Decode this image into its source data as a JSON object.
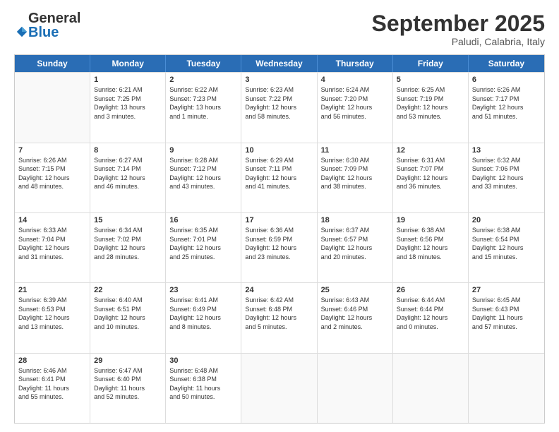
{
  "logo": {
    "general": "General",
    "blue": "Blue"
  },
  "title": "September 2025",
  "subtitle": "Paludi, Calabria, Italy",
  "headers": [
    "Sunday",
    "Monday",
    "Tuesday",
    "Wednesday",
    "Thursday",
    "Friday",
    "Saturday"
  ],
  "rows": [
    [
      {
        "day": "",
        "lines": []
      },
      {
        "day": "1",
        "lines": [
          "Sunrise: 6:21 AM",
          "Sunset: 7:25 PM",
          "Daylight: 13 hours",
          "and 3 minutes."
        ]
      },
      {
        "day": "2",
        "lines": [
          "Sunrise: 6:22 AM",
          "Sunset: 7:23 PM",
          "Daylight: 13 hours",
          "and 1 minute."
        ]
      },
      {
        "day": "3",
        "lines": [
          "Sunrise: 6:23 AM",
          "Sunset: 7:22 PM",
          "Daylight: 12 hours",
          "and 58 minutes."
        ]
      },
      {
        "day": "4",
        "lines": [
          "Sunrise: 6:24 AM",
          "Sunset: 7:20 PM",
          "Daylight: 12 hours",
          "and 56 minutes."
        ]
      },
      {
        "day": "5",
        "lines": [
          "Sunrise: 6:25 AM",
          "Sunset: 7:19 PM",
          "Daylight: 12 hours",
          "and 53 minutes."
        ]
      },
      {
        "day": "6",
        "lines": [
          "Sunrise: 6:26 AM",
          "Sunset: 7:17 PM",
          "Daylight: 12 hours",
          "and 51 minutes."
        ]
      }
    ],
    [
      {
        "day": "7",
        "lines": [
          "Sunrise: 6:26 AM",
          "Sunset: 7:15 PM",
          "Daylight: 12 hours",
          "and 48 minutes."
        ]
      },
      {
        "day": "8",
        "lines": [
          "Sunrise: 6:27 AM",
          "Sunset: 7:14 PM",
          "Daylight: 12 hours",
          "and 46 minutes."
        ]
      },
      {
        "day": "9",
        "lines": [
          "Sunrise: 6:28 AM",
          "Sunset: 7:12 PM",
          "Daylight: 12 hours",
          "and 43 minutes."
        ]
      },
      {
        "day": "10",
        "lines": [
          "Sunrise: 6:29 AM",
          "Sunset: 7:11 PM",
          "Daylight: 12 hours",
          "and 41 minutes."
        ]
      },
      {
        "day": "11",
        "lines": [
          "Sunrise: 6:30 AM",
          "Sunset: 7:09 PM",
          "Daylight: 12 hours",
          "and 38 minutes."
        ]
      },
      {
        "day": "12",
        "lines": [
          "Sunrise: 6:31 AM",
          "Sunset: 7:07 PM",
          "Daylight: 12 hours",
          "and 36 minutes."
        ]
      },
      {
        "day": "13",
        "lines": [
          "Sunrise: 6:32 AM",
          "Sunset: 7:06 PM",
          "Daylight: 12 hours",
          "and 33 minutes."
        ]
      }
    ],
    [
      {
        "day": "14",
        "lines": [
          "Sunrise: 6:33 AM",
          "Sunset: 7:04 PM",
          "Daylight: 12 hours",
          "and 31 minutes."
        ]
      },
      {
        "day": "15",
        "lines": [
          "Sunrise: 6:34 AM",
          "Sunset: 7:02 PM",
          "Daylight: 12 hours",
          "and 28 minutes."
        ]
      },
      {
        "day": "16",
        "lines": [
          "Sunrise: 6:35 AM",
          "Sunset: 7:01 PM",
          "Daylight: 12 hours",
          "and 25 minutes."
        ]
      },
      {
        "day": "17",
        "lines": [
          "Sunrise: 6:36 AM",
          "Sunset: 6:59 PM",
          "Daylight: 12 hours",
          "and 23 minutes."
        ]
      },
      {
        "day": "18",
        "lines": [
          "Sunrise: 6:37 AM",
          "Sunset: 6:57 PM",
          "Daylight: 12 hours",
          "and 20 minutes."
        ]
      },
      {
        "day": "19",
        "lines": [
          "Sunrise: 6:38 AM",
          "Sunset: 6:56 PM",
          "Daylight: 12 hours",
          "and 18 minutes."
        ]
      },
      {
        "day": "20",
        "lines": [
          "Sunrise: 6:38 AM",
          "Sunset: 6:54 PM",
          "Daylight: 12 hours",
          "and 15 minutes."
        ]
      }
    ],
    [
      {
        "day": "21",
        "lines": [
          "Sunrise: 6:39 AM",
          "Sunset: 6:53 PM",
          "Daylight: 12 hours",
          "and 13 minutes."
        ]
      },
      {
        "day": "22",
        "lines": [
          "Sunrise: 6:40 AM",
          "Sunset: 6:51 PM",
          "Daylight: 12 hours",
          "and 10 minutes."
        ]
      },
      {
        "day": "23",
        "lines": [
          "Sunrise: 6:41 AM",
          "Sunset: 6:49 PM",
          "Daylight: 12 hours",
          "and 8 minutes."
        ]
      },
      {
        "day": "24",
        "lines": [
          "Sunrise: 6:42 AM",
          "Sunset: 6:48 PM",
          "Daylight: 12 hours",
          "and 5 minutes."
        ]
      },
      {
        "day": "25",
        "lines": [
          "Sunrise: 6:43 AM",
          "Sunset: 6:46 PM",
          "Daylight: 12 hours",
          "and 2 minutes."
        ]
      },
      {
        "day": "26",
        "lines": [
          "Sunrise: 6:44 AM",
          "Sunset: 6:44 PM",
          "Daylight: 12 hours",
          "and 0 minutes."
        ]
      },
      {
        "day": "27",
        "lines": [
          "Sunrise: 6:45 AM",
          "Sunset: 6:43 PM",
          "Daylight: 11 hours",
          "and 57 minutes."
        ]
      }
    ],
    [
      {
        "day": "28",
        "lines": [
          "Sunrise: 6:46 AM",
          "Sunset: 6:41 PM",
          "Daylight: 11 hours",
          "and 55 minutes."
        ]
      },
      {
        "day": "29",
        "lines": [
          "Sunrise: 6:47 AM",
          "Sunset: 6:40 PM",
          "Daylight: 11 hours",
          "and 52 minutes."
        ]
      },
      {
        "day": "30",
        "lines": [
          "Sunrise: 6:48 AM",
          "Sunset: 6:38 PM",
          "Daylight: 11 hours",
          "and 50 minutes."
        ]
      },
      {
        "day": "",
        "lines": []
      },
      {
        "day": "",
        "lines": []
      },
      {
        "day": "",
        "lines": []
      },
      {
        "day": "",
        "lines": []
      }
    ]
  ]
}
